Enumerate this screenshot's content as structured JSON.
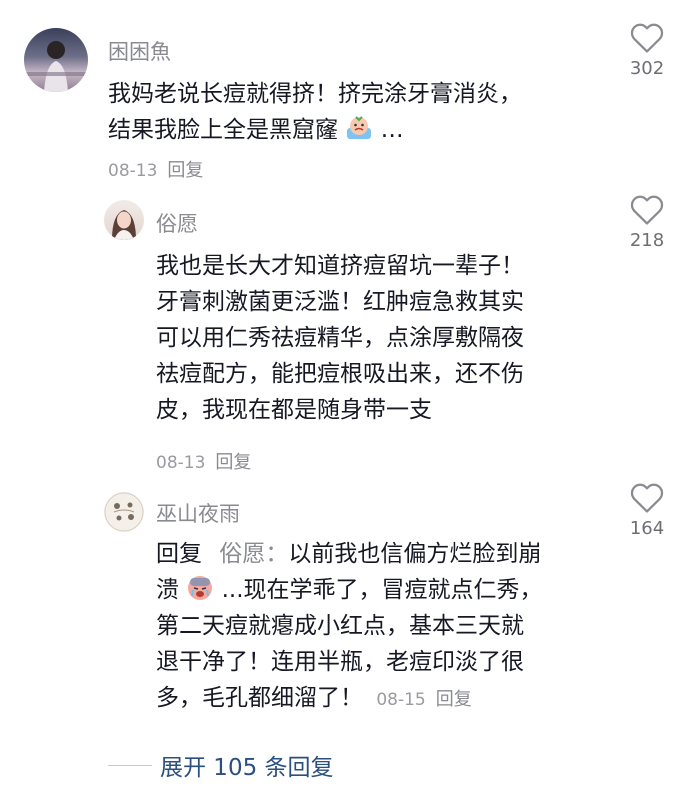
{
  "comments": [
    {
      "user": "困困魚",
      "line1": "我妈老说长痘就得挤！挤完涂牙膏消炎，",
      "line2_pre": "结果我脸上全是黑窟窿",
      "line2_post": " …",
      "emoji": "sweating-emoji",
      "date": "08-13",
      "reply_label": "回复",
      "likes": "302"
    },
    {
      "user": "俗愿",
      "lines": [
        "我也是长大才知道挤痘留坑一辈子！",
        "牙膏刺激菌更泛滥！红肿痘急救其实",
        "可以用仁秀祛痘精华，点涂厚敷隔夜",
        "祛痘配方，能把痘根吸出来，还不伤",
        "皮，我现在都是随身带一支"
      ],
      "date": "08-13",
      "reply_label": "回复",
      "likes": "218"
    },
    {
      "user": "巫山夜雨",
      "reply_prefix": "回复",
      "mention": "俗愿：",
      "line1_rest": "以前我也信偏方烂脸到崩",
      "line2_pre": "溃",
      "emoji": "crying-emoji",
      "line2_post": "...现在学乖了，冒痘就点仁秀，",
      "line3": "第二天痘就瘪成小红点，基本三天就",
      "line4": "退干净了！连用半瓶，老痘印淡了很",
      "line5": "多，毛孔都细溜了！",
      "date": "08-15",
      "reply_label": "回复",
      "likes": "164"
    }
  ],
  "expand_label": "展开 105 条回复",
  "colors": {
    "link": "#2b4f7e",
    "muted": "#8a8b91",
    "text": "#161823"
  }
}
